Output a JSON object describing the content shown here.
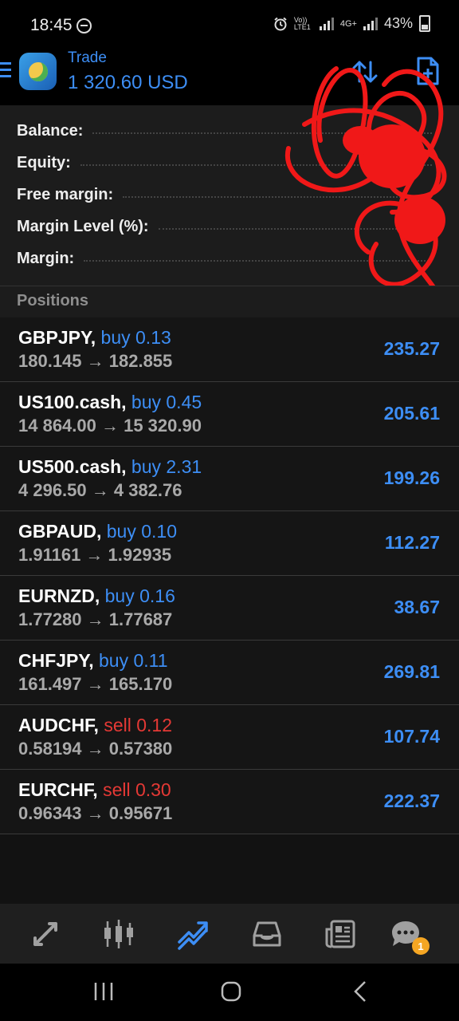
{
  "status_bar": {
    "time": "18:45",
    "network_1": "Vo)) LTE1",
    "network_2": "4G+",
    "battery": "43%"
  },
  "header": {
    "title": "Trade",
    "balance": "1 320.60 USD"
  },
  "summary": {
    "rows": [
      {
        "label": "Balance:",
        "value": ""
      },
      {
        "label": "Equity:",
        "value": ""
      },
      {
        "label": "Free margin:",
        "value": ""
      },
      {
        "label": "Margin Level (%):",
        "value": ""
      },
      {
        "label": "Margin:",
        "value": ""
      }
    ]
  },
  "positions_header": "Positions",
  "positions": [
    {
      "symbol": "GBPJPY,",
      "side": "buy 0.13",
      "type": "buy",
      "prices": "180.145 → 182.855",
      "profit": "235.27"
    },
    {
      "symbol": "US100.cash,",
      "side": "buy 0.45",
      "type": "buy",
      "prices": "14 864.00 → 15 320.90",
      "profit": "205.61"
    },
    {
      "symbol": "US500.cash,",
      "side": "buy 2.31",
      "type": "buy",
      "prices": "4 296.50 → 4 382.76",
      "profit": "199.26"
    },
    {
      "symbol": "GBPAUD,",
      "side": "buy 0.10",
      "type": "buy",
      "prices": "1.91161 → 1.92935",
      "profit": "112.27"
    },
    {
      "symbol": "EURNZD,",
      "side": "buy 0.16",
      "type": "buy",
      "prices": "1.77280 → 1.77687",
      "profit": "38.67"
    },
    {
      "symbol": "CHFJPY,",
      "side": "buy 0.11",
      "type": "buy",
      "prices": "161.497 → 165.170",
      "profit": "269.81"
    },
    {
      "symbol": "AUDCHF,",
      "side": "sell 0.12",
      "type": "sell",
      "prices": "0.58194 → 0.57380",
      "profit": "107.74"
    },
    {
      "symbol": "EURCHF,",
      "side": "sell 0.30",
      "type": "sell",
      "prices": "0.96343 → 0.95671",
      "profit": "222.37"
    }
  ],
  "bottom_nav": {
    "items": [
      {
        "icon": "quotes-icon"
      },
      {
        "icon": "chart-icon"
      },
      {
        "icon": "trade-icon"
      },
      {
        "icon": "history-icon"
      },
      {
        "icon": "news-icon"
      },
      {
        "icon": "chat-icon",
        "badge": "1"
      }
    ]
  },
  "colors": {
    "accent": "#3d8ef5",
    "sell": "#e53935",
    "background": "#121212"
  }
}
